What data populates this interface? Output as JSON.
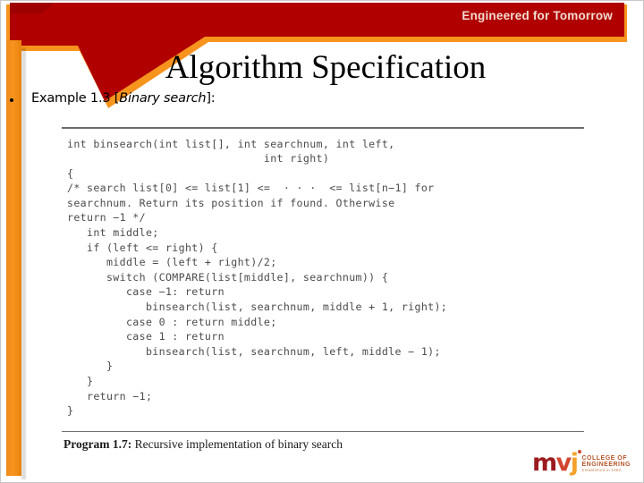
{
  "slide": {
    "title": "Algorithm Specification",
    "tagline": "Engineered for Tomorrow",
    "bullet": {
      "prefix": "Example 1.3 [",
      "emphasis": "Binary search",
      "suffix": "]:"
    }
  },
  "figure": {
    "code_lines": [
      "int binsearch(int list[], int searchnum, int left,",
      "                              int right)",
      "{",
      "/* search list[0] <= list[1] <=  · · ·  <= list[n−1] for",
      "searchnum. Return its position if found. Otherwise",
      "return −1 */",
      "   int middle;",
      "   if (left <= right) {",
      "      middle = (left + right)/2;",
      "      switch (COMPARE(list[middle], searchnum)) {",
      "         case −1: return",
      "            binsearch(list, searchnum, middle + 1, right);",
      "         case 0 : return middle;",
      "         case 1 : return",
      "            binsearch(list, searchnum, left, middle − 1);",
      "      }",
      "   }",
      "   return −1;",
      "}"
    ],
    "caption_label": "Program 1.7:",
    "caption_text": " Recursive implementation of binary search"
  },
  "logo": {
    "mark_m": "m",
    "mark_v": "v",
    "mark_j": "j",
    "line1": "COLLEGE OF",
    "line2": "ENGINEERING",
    "line3": "Established in 1982"
  },
  "colors": {
    "banner_red": "#B00000",
    "accent_orange": "#F7941E",
    "logo_maroon": "#9B1B1E",
    "logo_orange": "#F2A22C"
  }
}
